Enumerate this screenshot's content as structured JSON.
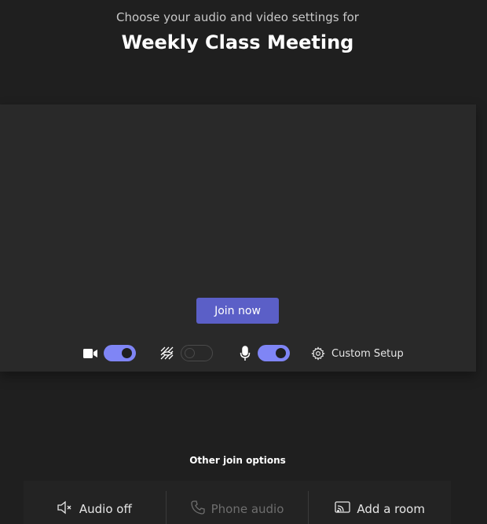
{
  "header": {
    "subtitle": "Choose your audio and video settings for",
    "title": "Weekly Class Meeting"
  },
  "preview": {
    "join_label": "Join now",
    "controls": {
      "camera": {
        "icon": "camera-icon",
        "enabled": true
      },
      "background_effects": {
        "icon": "background-effects-icon",
        "enabled": false
      },
      "microphone": {
        "icon": "microphone-icon",
        "enabled": true
      },
      "custom_setup": {
        "icon": "gear-icon",
        "label": "Custom Setup"
      }
    }
  },
  "other_options": {
    "heading": "Other join options",
    "items": [
      {
        "icon": "speaker-off-icon",
        "label": "Audio off",
        "disabled": false
      },
      {
        "icon": "phone-icon",
        "label": "Phone audio",
        "disabled": true
      },
      {
        "icon": "cast-icon",
        "label": "Add a room",
        "disabled": false
      }
    ]
  },
  "colors": {
    "background": "#1f1f1f",
    "panel": "#292929",
    "accent": "#5b5fc7",
    "toggle_on": "#7f85f5"
  }
}
